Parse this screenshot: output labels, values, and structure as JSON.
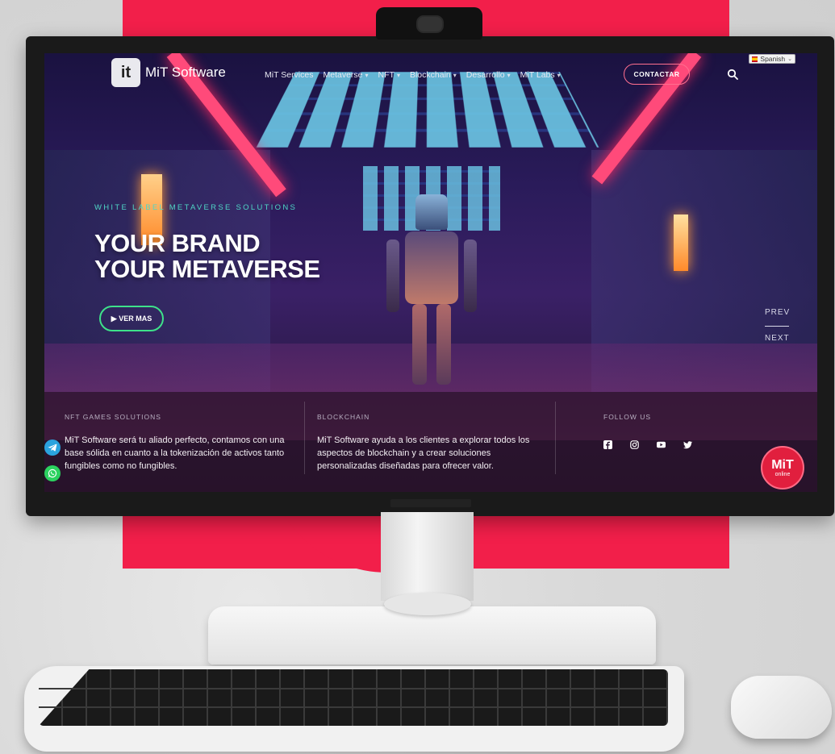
{
  "header": {
    "logo_mark": "it",
    "logo_text": "MiT Software",
    "nav": [
      {
        "label": "MiT Services",
        "has_dropdown": false
      },
      {
        "label": "Metaverse",
        "has_dropdown": true
      },
      {
        "label": "NFT",
        "has_dropdown": true
      },
      {
        "label": "Blockchain",
        "has_dropdown": true
      },
      {
        "label": "Desarrollo",
        "has_dropdown": true
      },
      {
        "label": "MiT Labs",
        "has_dropdown": true
      }
    ],
    "caret": "▾",
    "contact_label": "CONTACTAR",
    "language": "Spanish",
    "language_chevron": "⌄"
  },
  "hero": {
    "eyebrow": "WHITE LABEL METAVERSE SOLUTIONS",
    "title_line1": "YOUR BRAND",
    "title_line2": "YOUR METAVERSE",
    "button_label": "▶ VER MAS",
    "prev_label": "PREV",
    "next_label": "NEXT"
  },
  "panel": {
    "col1": {
      "title": "NFT GAMES SOLUTIONS",
      "text": "MiT Software será tu aliado perfecto, contamos con una base sólida en cuanto a la tokenización de activos tanto fungibles como no fungibles."
    },
    "col2": {
      "title": "BLOCKCHAIN",
      "text": "MiT Software ayuda a los clientes a explorar todos los aspectos de blockchain y a crear soluciones personalizadas diseñadas para ofrecer valor."
    },
    "col3": {
      "title": "FOLLOW US",
      "icons": [
        "facebook-icon",
        "instagram-icon",
        "youtube-icon",
        "twitter-icon"
      ]
    }
  },
  "chat_badge": {
    "line1": "MiT",
    "line2": "online"
  },
  "floating_icons": [
    "telegram-icon",
    "whatsapp-icon"
  ],
  "colors": {
    "brand_red": "#f21f4a",
    "accent_teal": "#4fd6c6",
    "accent_green": "#3ee28a",
    "contact_border": "#ff6f8f"
  }
}
